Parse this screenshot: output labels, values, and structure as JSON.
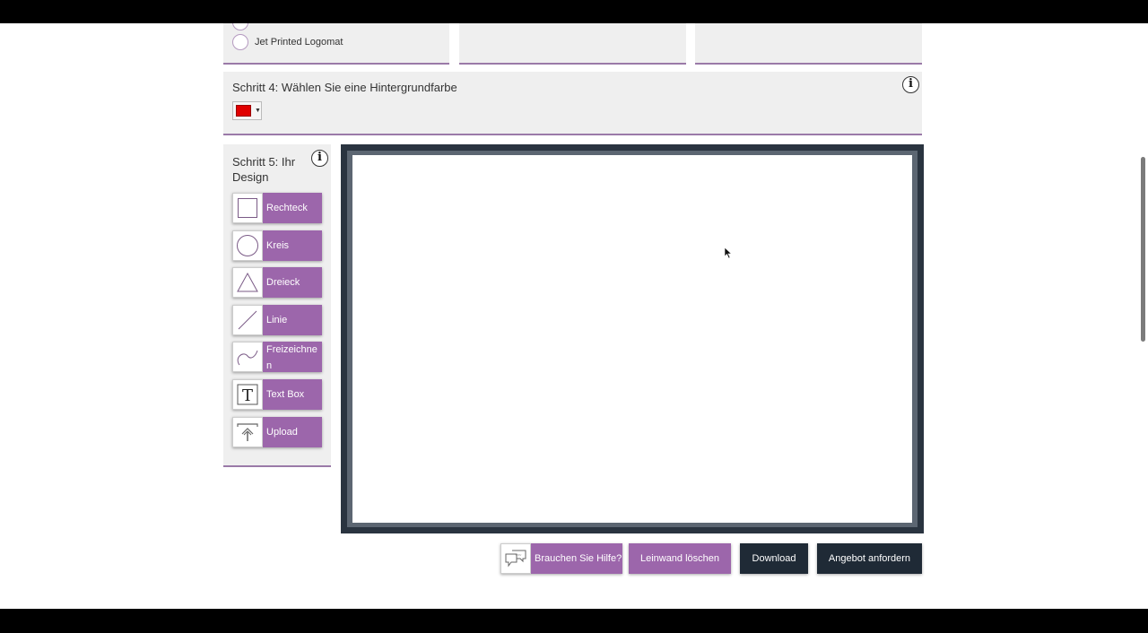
{
  "step3": {
    "options": [
      {
        "label": "Jet Printed Logomat"
      }
    ]
  },
  "step4": {
    "title": "Schritt 4: Wählen Sie eine Hintergrundfarbe",
    "info_label": "i",
    "selected_color": "#e00000",
    "dropdown_caret": "▼"
  },
  "step5": {
    "title": "Schritt 5: Ihr Design",
    "info_label": "i",
    "tools": [
      {
        "label": "Rechteck",
        "icon": "rectangle-icon"
      },
      {
        "label": "Kreis",
        "icon": "circle-icon"
      },
      {
        "label": "Dreieck",
        "icon": "triangle-icon"
      },
      {
        "label": "Linie",
        "icon": "line-icon"
      },
      {
        "label": "Freizeichnen",
        "icon": "freehand-icon"
      },
      {
        "label": "Text Box",
        "icon": "text-icon"
      },
      {
        "label": "Upload",
        "icon": "upload-icon"
      }
    ]
  },
  "actions": {
    "help": "Brauchen Sie Hilfe?",
    "clear": "Leinwand löschen",
    "download": "Download",
    "quote": "Angebot anfordern"
  },
  "colors": {
    "accent_purple": "#9c66ab",
    "dark_button": "#1f2a36",
    "panel_bg": "#efefef"
  }
}
